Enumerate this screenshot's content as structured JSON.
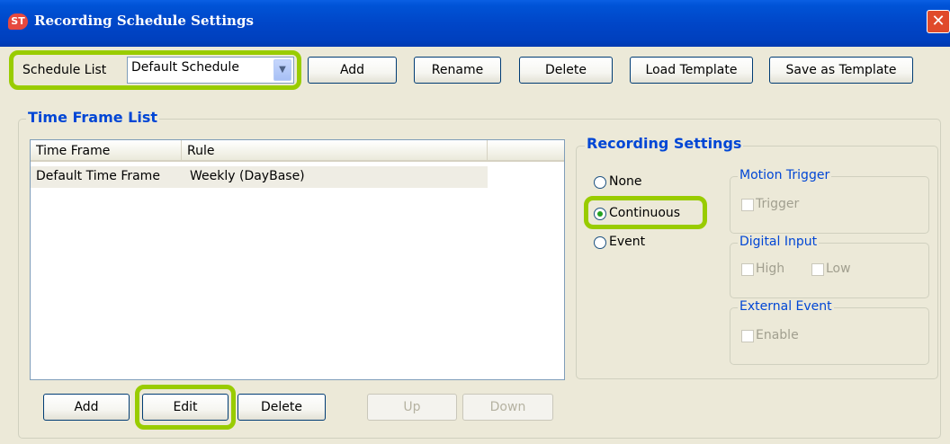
{
  "window": {
    "title": "Recording Schedule Settings",
    "app_icon": "ST",
    "close_glyph": "✕"
  },
  "schedule": {
    "label": "Schedule List",
    "selected": "Default Schedule",
    "buttons": {
      "add": "Add",
      "rename": "Rename",
      "delete": "Delete",
      "load_template": "Load Template",
      "save_template": "Save as Template"
    }
  },
  "time_frame": {
    "group_title": "Time Frame List",
    "columns": [
      "Time Frame",
      "Rule"
    ],
    "rows": [
      {
        "time_frame": "Default Time Frame",
        "rule": "Weekly (DayBase)"
      }
    ],
    "buttons": {
      "add": "Add",
      "edit": "Edit",
      "delete": "Delete",
      "up": "Up",
      "down": "Down"
    }
  },
  "recording": {
    "group_title": "Recording Settings",
    "options": {
      "none": "None",
      "continuous": "Continuous",
      "event": "Event"
    },
    "selected": "continuous",
    "motion_trigger": {
      "title": "Motion Trigger",
      "trigger": "Trigger"
    },
    "digital_input": {
      "title": "Digital Input",
      "high": "High",
      "low": "Low"
    },
    "external_event": {
      "title": "External Event",
      "enable": "Enable"
    }
  },
  "colors": {
    "highlight": "#99cc00",
    "group_title": "#0046d5",
    "titlebar": "#0053d6",
    "close_button": "#e04a2a"
  }
}
